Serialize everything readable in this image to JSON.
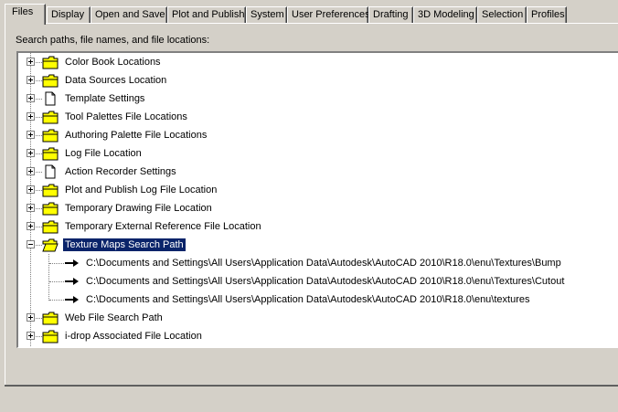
{
  "tabs": [
    {
      "label": "Files",
      "active": true
    },
    {
      "label": "Display"
    },
    {
      "label": "Open and Save"
    },
    {
      "label": "Plot and Publish"
    },
    {
      "label": "System"
    },
    {
      "label": "User Preferences"
    },
    {
      "label": "Drafting"
    },
    {
      "label": "3D Modeling"
    },
    {
      "label": "Selection"
    },
    {
      "label": "Profiles"
    }
  ],
  "caption": "Search paths, file names, and file locations:",
  "tree": {
    "items": [
      {
        "label": "Color Book Locations",
        "icon": "folder-icon",
        "expanded": false
      },
      {
        "label": "Data Sources Location",
        "icon": "folder-icon",
        "expanded": false
      },
      {
        "label": "Template Settings",
        "icon": "document-icon",
        "expanded": false
      },
      {
        "label": "Tool Palettes File Locations",
        "icon": "folder-icon",
        "expanded": false
      },
      {
        "label": "Authoring Palette File Locations",
        "icon": "folder-icon",
        "expanded": false
      },
      {
        "label": "Log File Location",
        "icon": "folder-icon",
        "expanded": false
      },
      {
        "label": "Action Recorder Settings",
        "icon": "document-icon",
        "expanded": false
      },
      {
        "label": "Plot and Publish Log File Location",
        "icon": "folder-icon",
        "expanded": false
      },
      {
        "label": "Temporary Drawing File Location",
        "icon": "folder-icon",
        "expanded": false
      },
      {
        "label": "Temporary External Reference File Location",
        "icon": "folder-icon",
        "expanded": false
      },
      {
        "label": "Texture Maps Search Path",
        "icon": "open-folder-icon",
        "expanded": true,
        "selected": true
      },
      {
        "label": "Web File Search Path",
        "icon": "folder-icon",
        "expanded": false
      },
      {
        "label": "i-drop Associated File Location",
        "icon": "folder-icon",
        "expanded": false
      }
    ],
    "texture_paths": [
      "C:\\Documents and Settings\\All Users\\Application Data\\Autodesk\\AutoCAD 2010\\R18.0\\enu\\Textures\\Bump",
      "C:\\Documents and Settings\\All Users\\Application Data\\Autodesk\\AutoCAD 2010\\R18.0\\enu\\Textures\\Cutout",
      "C:\\Documents and Settings\\All Users\\Application Data\\Autodesk\\AutoCAD 2010\\R18.0\\enu\\textures"
    ],
    "path_icon": "arrow-right-icon"
  },
  "colors": {
    "dialog_bg": "#d4d0c8",
    "selection_bg": "#0a246a",
    "folder_yellow": "#ffff00"
  }
}
